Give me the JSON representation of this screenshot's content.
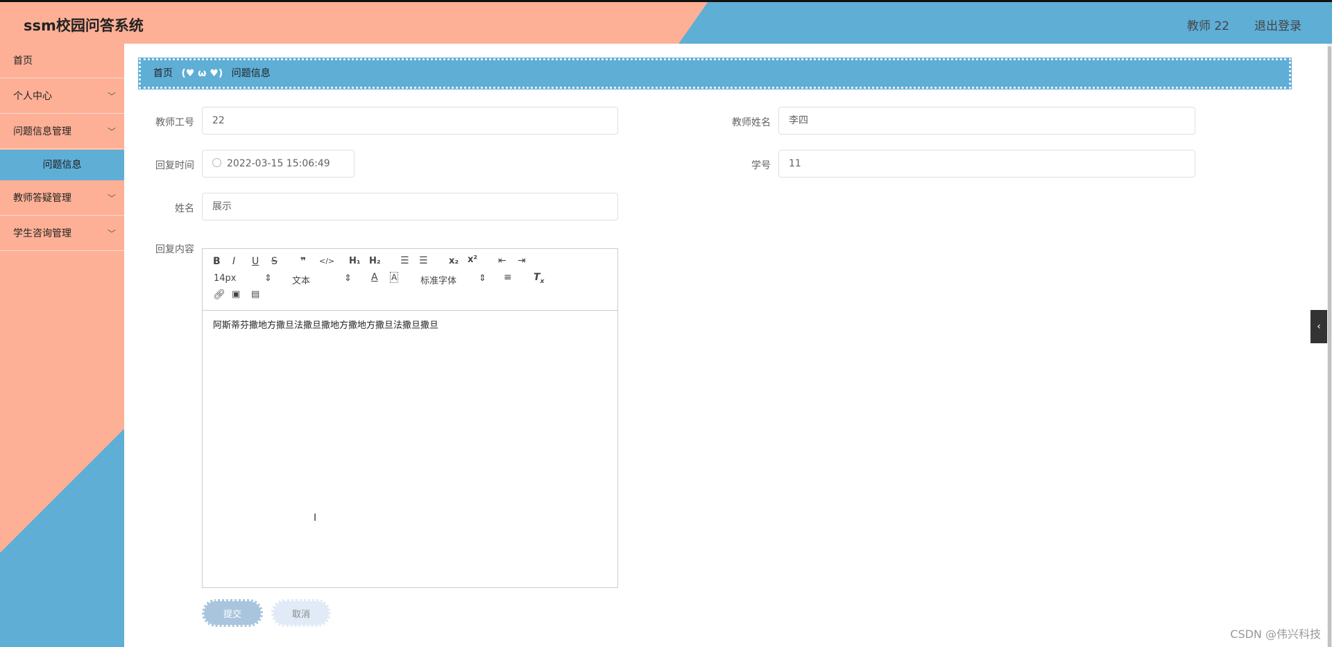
{
  "header": {
    "title": "ssm校园问答系统",
    "user": "教师 22",
    "logout": "退出登录"
  },
  "sidebar": {
    "items": [
      {
        "label": "首页"
      },
      {
        "label": "个人中心"
      },
      {
        "label": "问题信息管理"
      },
      {
        "label": "问题信息"
      },
      {
        "label": "教师答疑管理"
      },
      {
        "label": "学生咨询管理"
      }
    ]
  },
  "breadcrumb": {
    "home": "首页",
    "separator": "(♥ ω ♥)",
    "current": "问题信息"
  },
  "form": {
    "teacher_id_label": "教师工号",
    "teacher_id": "22",
    "teacher_name_label": "教师姓名",
    "teacher_name": "李四",
    "reply_time_label": "回复时间",
    "reply_time": "2022-03-15 15:06:49",
    "student_no_label": "学号",
    "student_no": "11",
    "name_label": "姓名",
    "name": "展示",
    "reply_content_label": "回复内容",
    "reply_content": "阿斯蒂芬撒地方撒旦法撒旦撒地方撒地方撒旦法撒旦撒旦"
  },
  "editor": {
    "size_select": "14px",
    "text_select": "文本",
    "font_select": "标准字体"
  },
  "buttons": {
    "submit": "提交",
    "cancel": "取消"
  },
  "watermark": "CSDN @伟兴科技",
  "colors": {
    "peach": "#fdb096",
    "blue": "#5eaed6"
  }
}
